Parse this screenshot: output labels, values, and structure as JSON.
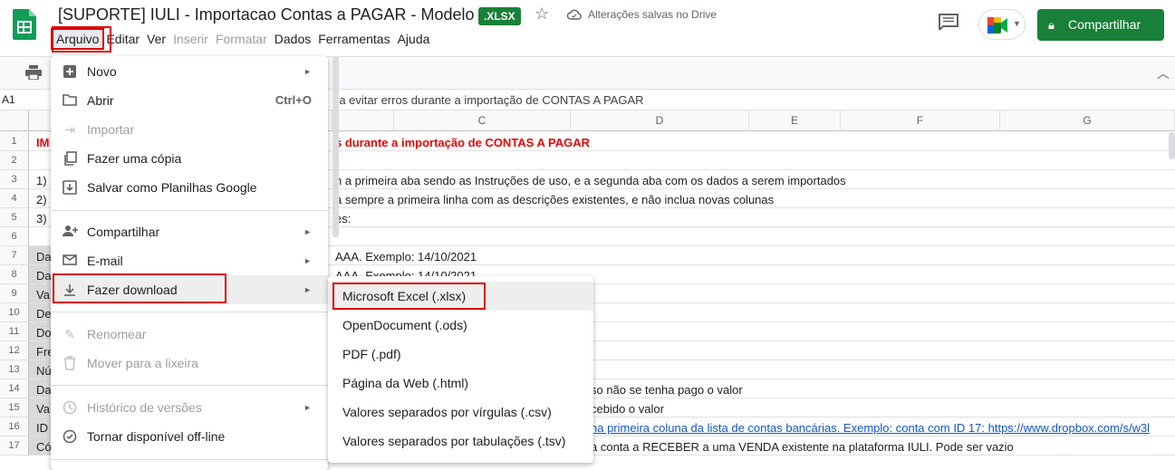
{
  "header": {
    "title": "[SUPORTE] IULI - Importacao Contas a PAGAR - Modelo",
    "badge": ".XLSX",
    "saved_status": "Alterações salvas no Drive",
    "share_label": "Compartilhar",
    "brand_color": "#188038"
  },
  "menubar": {
    "items": [
      "Arquivo",
      "Editar",
      "Ver",
      "Inserir",
      "Formatar",
      "Dados",
      "Ferramentas",
      "Ajuda"
    ]
  },
  "formula": {
    "cell_ref": "A1",
    "content": "ra evitar erros durante a importação de CONTAS A PAGAR"
  },
  "grid": {
    "columns": [
      "C",
      "D",
      "E",
      "F",
      "G"
    ],
    "rows": [
      "1",
      "2",
      "3",
      "4",
      "5",
      "6",
      "7",
      "8",
      "9",
      "10",
      "11",
      "12",
      "13",
      "14",
      "15",
      "16",
      "17"
    ],
    "cells": {
      "r1a": "IM",
      "r1b": "s durante a importação de CONTAS A PAGAR",
      "r3a": "1)",
      "r3b": "n a primeira aba sendo as Instruções de uso, e a segunda aba com os dados a serem importados",
      "r4a": "2)",
      "r4b": "a sempre a primeira linha com as descrições existentes, e não inclua novas colunas",
      "r5a": "3)",
      "r5b": "es:",
      "r7a": "Da",
      "r7b": "AAA. Exemplo: 14/10/2021",
      "r8a": "Da",
      "r8b": "AAA. Exemplo: 14/10/2021",
      "r9a": "Va",
      "r10a": "De",
      "r11a": "Do",
      "r12a": "Fre",
      "r13a": "Nú",
      "r14a": "Da",
      "r14b": "so não se tenha pago o valor",
      "r15a": "Va",
      "r15b": "cebido o valor",
      "r16a": "ID",
      "r16b": "na primeira coluna da lista de contas bancárias. Exemplo: conta com ID 17: https://www.dropbox.com/s/w3l",
      "r17a": "Có",
      "r17b": "a conta a RECEBER a uma VENDA existente na plataforma IULI. Pode ser vazio"
    }
  },
  "file_menu": {
    "new": "Novo",
    "open": "Abrir",
    "open_shortcut": "Ctrl+O",
    "import": "Importar",
    "copy": "Fazer uma cópia",
    "save_as_sheets": "Salvar como Planilhas Google",
    "share": "Compartilhar",
    "email": "E-mail",
    "download": "Fazer download",
    "rename": "Renomear",
    "trash": "Mover para a lixeira",
    "history": "Histórico de versões",
    "offline": "Tornar disponível off-line"
  },
  "download_menu": {
    "items": [
      "Microsoft Excel (.xlsx)",
      "OpenDocument (.ods)",
      "PDF (.pdf)",
      "Página da Web (.html)",
      "Valores separados por vírgulas (.csv)",
      "Valores separados por tabulações (.tsv)"
    ]
  }
}
